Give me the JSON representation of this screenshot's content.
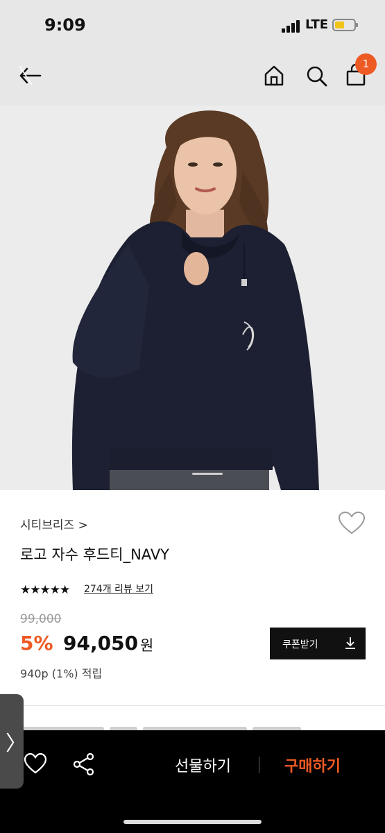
{
  "status": {
    "time": "9:09",
    "network": "LTE",
    "battery_color": "#f0c419"
  },
  "nav": {
    "back_icon": "back-arrow-icon",
    "home_icon": "home-icon",
    "search_icon": "search-icon",
    "cart_icon": "cart-icon",
    "cart_badge": "1"
  },
  "product": {
    "image_alt": "product-photo",
    "brand": "시티브리즈 >",
    "title": "로고 자수 후드티_NAVY",
    "rating_stars": "★★★★★",
    "review_link": "274개 리뷰 보기",
    "original_price": "99,000",
    "discount": "5%",
    "price": "94,050",
    "currency": "원",
    "points": "940p (1%) 적립",
    "coupon_button": "쿠폰받기"
  },
  "bottom_bar": {
    "gift_button": "선물하기",
    "buy_button": "구매하기"
  },
  "side_handle": {
    "glyph": "〉"
  },
  "colors": {
    "accent": "#ee5a24",
    "dark": "#111111",
    "top_bar_bg": "#e7e7e7"
  }
}
